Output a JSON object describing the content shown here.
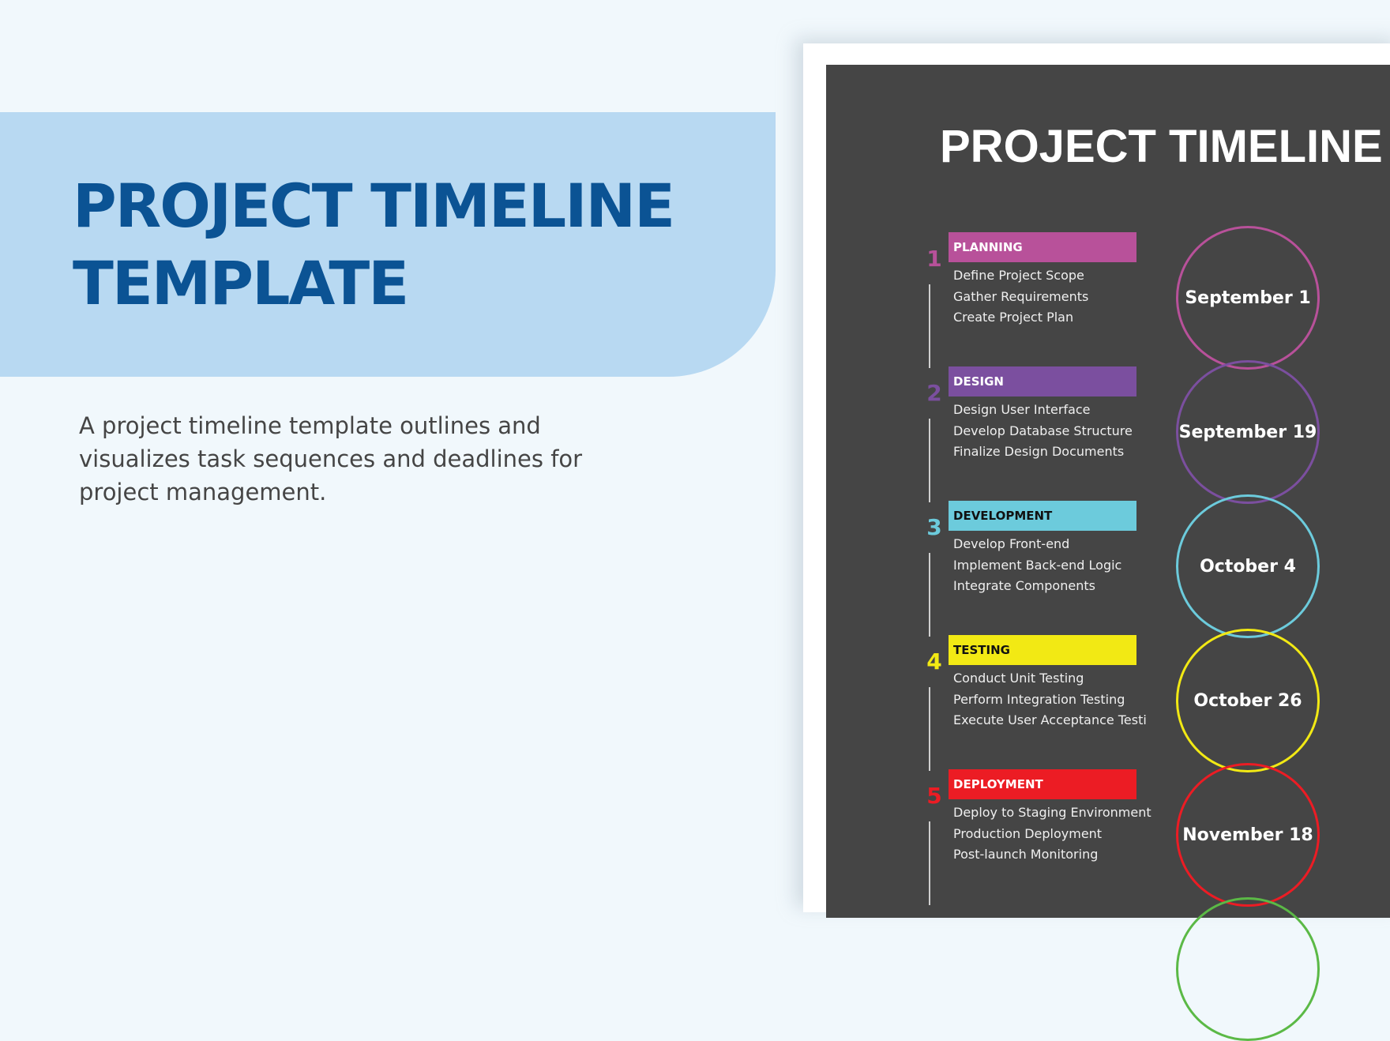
{
  "hero": {
    "title_line1": "PROJECT TIMELINE",
    "title_line2": "TEMPLATE",
    "description": "A project timeline template outlines and visualizes task sequences and deadlines for project management."
  },
  "poster": {
    "title": "PROJECT TIMELINE",
    "phases": [
      {
        "number": "1",
        "name": "PLANNING",
        "color": "#b8519a",
        "label_color": "#ffffff",
        "tasks": [
          "Define Project Scope",
          "Gather Requirements",
          "Create Project Plan"
        ],
        "date": "September 1"
      },
      {
        "number": "2",
        "name": "DESIGN",
        "color": "#7b4f9f",
        "label_color": "#ffffff",
        "tasks": [
          "Design User Interface",
          "Develop Database Structure",
          "Finalize Design Documents"
        ],
        "date": "September 19"
      },
      {
        "number": "3",
        "name": "DEVELOPMENT",
        "color": "#6ccbdc",
        "label_color": "#111111",
        "tasks": [
          "Develop Front-end",
          "Implement Back-end Logic",
          "Integrate Components"
        ],
        "date": "October 4"
      },
      {
        "number": "4",
        "name": "TESTING",
        "color": "#f2e914",
        "label_color": "#111111",
        "tasks": [
          "Conduct Unit Testing",
          "Perform Integration Testing",
          "Execute User Acceptance Testi"
        ],
        "date": "October 26"
      },
      {
        "number": "5",
        "name": "DEPLOYMENT",
        "color": "#ec1c24",
        "label_color": "#ffffff",
        "tasks": [
          "Deploy to Staging Environment",
          "Production Deployment",
          "Post-launch Monitoring"
        ],
        "date": "November 18"
      }
    ],
    "next_circle_color": "#5bb946"
  }
}
